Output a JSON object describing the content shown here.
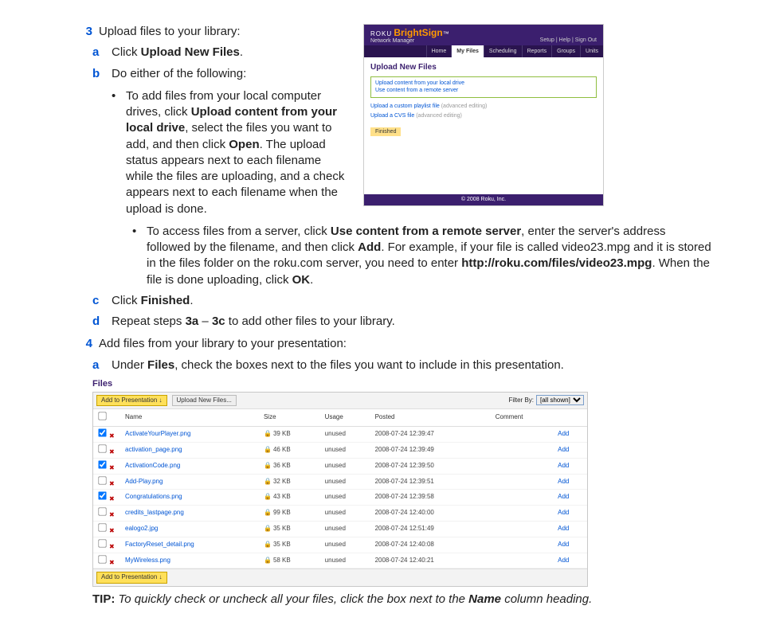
{
  "step3": {
    "num": "3",
    "title": "Upload files to your library:",
    "a_letter": "a",
    "a_pre": "Click ",
    "a_bold": "Upload New Files",
    "a_post": ".",
    "b_letter": "b",
    "b_text": "Do either of the following:",
    "bullet1": {
      "pre": "To add files from your local computer drives, click ",
      "b1": "Upload content from your local drive",
      "mid1": ", select the files you want to add, and then click ",
      "b2": "Open",
      "post": ". The upload status appears next to each filename while the files are uploading, and a check appears next to each filename when the upload is done."
    },
    "bullet2": {
      "pre": "To access files from a server, click ",
      "b1": "Use content from a remote server",
      "mid1": ", enter the server's address followed by the filename, and then click ",
      "b2": "Add",
      "mid2": ". For example, if your file is called video23.mpg and it is stored in the files folder on the roku.com server, you need to enter ",
      "b3": "http://roku.com/files/video23.mpg",
      "mid3": ". When the file is done uploading, click ",
      "b4": "OK",
      "post": "."
    },
    "c_letter": "c",
    "c_pre": "Click ",
    "c_bold": "Finished",
    "c_post": ".",
    "d_letter": "d",
    "d_pre": "Repeat steps ",
    "d_b1": "3a",
    "d_mid": " – ",
    "d_b2": "3c",
    "d_post": " to add other files to your library."
  },
  "step4": {
    "num": "4",
    "title": "Add files from your library to your presentation:",
    "a_letter": "a",
    "a_pre": "Under ",
    "a_bold": "Files",
    "a_post": ", check the boxes next to the files you want to include in this presentation."
  },
  "tip": {
    "label": "TIP:",
    "pre": " To quickly check or uncheck all your files, click the box next to the ",
    "bold": "Name",
    "post": " column heading."
  },
  "shot1": {
    "toplinks": "Setup  |  Help  |  Sign Out",
    "brand_roku": "ROKU",
    "brand_bs": "BrightSign",
    "brand_tm": "™",
    "brand_nm": "Network Manager",
    "nav": [
      "Home",
      "My Files",
      "Scheduling",
      "Reports",
      "Groups",
      "Units"
    ],
    "nav_active_index": 1,
    "h2": "Upload New Files",
    "green1": "Upload content from your local drive",
    "green2": "Use content from a remote server",
    "link1": "Upload a custom playlist file",
    "link2": "Upload a CVS file",
    "gray": "(advanced editing)",
    "finished": "Finished",
    "footer": "© 2008 Roku, Inc."
  },
  "files": {
    "title": "Files",
    "btn_add": "Add to Presentation ↓",
    "btn_upload": "Upload New Files...",
    "filter_label": "Filter By:",
    "filter_value": "[all shown]",
    "cols": {
      "name": "Name",
      "size": "Size",
      "usage": "Usage",
      "posted": "Posted",
      "comment": "Comment"
    },
    "add_label": "Add",
    "rows": [
      {
        "checked": true,
        "name": "ActivateYourPlayer.png",
        "size": "39 KB",
        "usage": "unused",
        "posted": "2008-07-24 12:39:47"
      },
      {
        "checked": false,
        "name": "activation_page.png",
        "size": "46 KB",
        "usage": "unused",
        "posted": "2008-07-24 12:39:49"
      },
      {
        "checked": true,
        "name": "ActivationCode.png",
        "size": "36 KB",
        "usage": "unused",
        "posted": "2008-07-24 12:39:50"
      },
      {
        "checked": false,
        "name": "Add-Play.png",
        "size": "32 KB",
        "usage": "unused",
        "posted": "2008-07-24 12:39:51"
      },
      {
        "checked": true,
        "name": "Congratulations.png",
        "size": "43 KB",
        "usage": "unused",
        "posted": "2008-07-24 12:39:58"
      },
      {
        "checked": false,
        "name": "credits_lastpage.png",
        "size": "99 KB",
        "usage": "unused",
        "posted": "2008-07-24 12:40:00"
      },
      {
        "checked": false,
        "name": "ealogo2.jpg",
        "size": "35 KB",
        "usage": "unused",
        "posted": "2008-07-24 12:51:49"
      },
      {
        "checked": false,
        "name": "FactoryReset_detail.png",
        "size": "35 KB",
        "usage": "unused",
        "posted": "2008-07-24 12:40:08"
      },
      {
        "checked": false,
        "name": "MyWireless.png",
        "size": "58 KB",
        "usage": "unused",
        "posted": "2008-07-24 12:40:21"
      }
    ]
  }
}
